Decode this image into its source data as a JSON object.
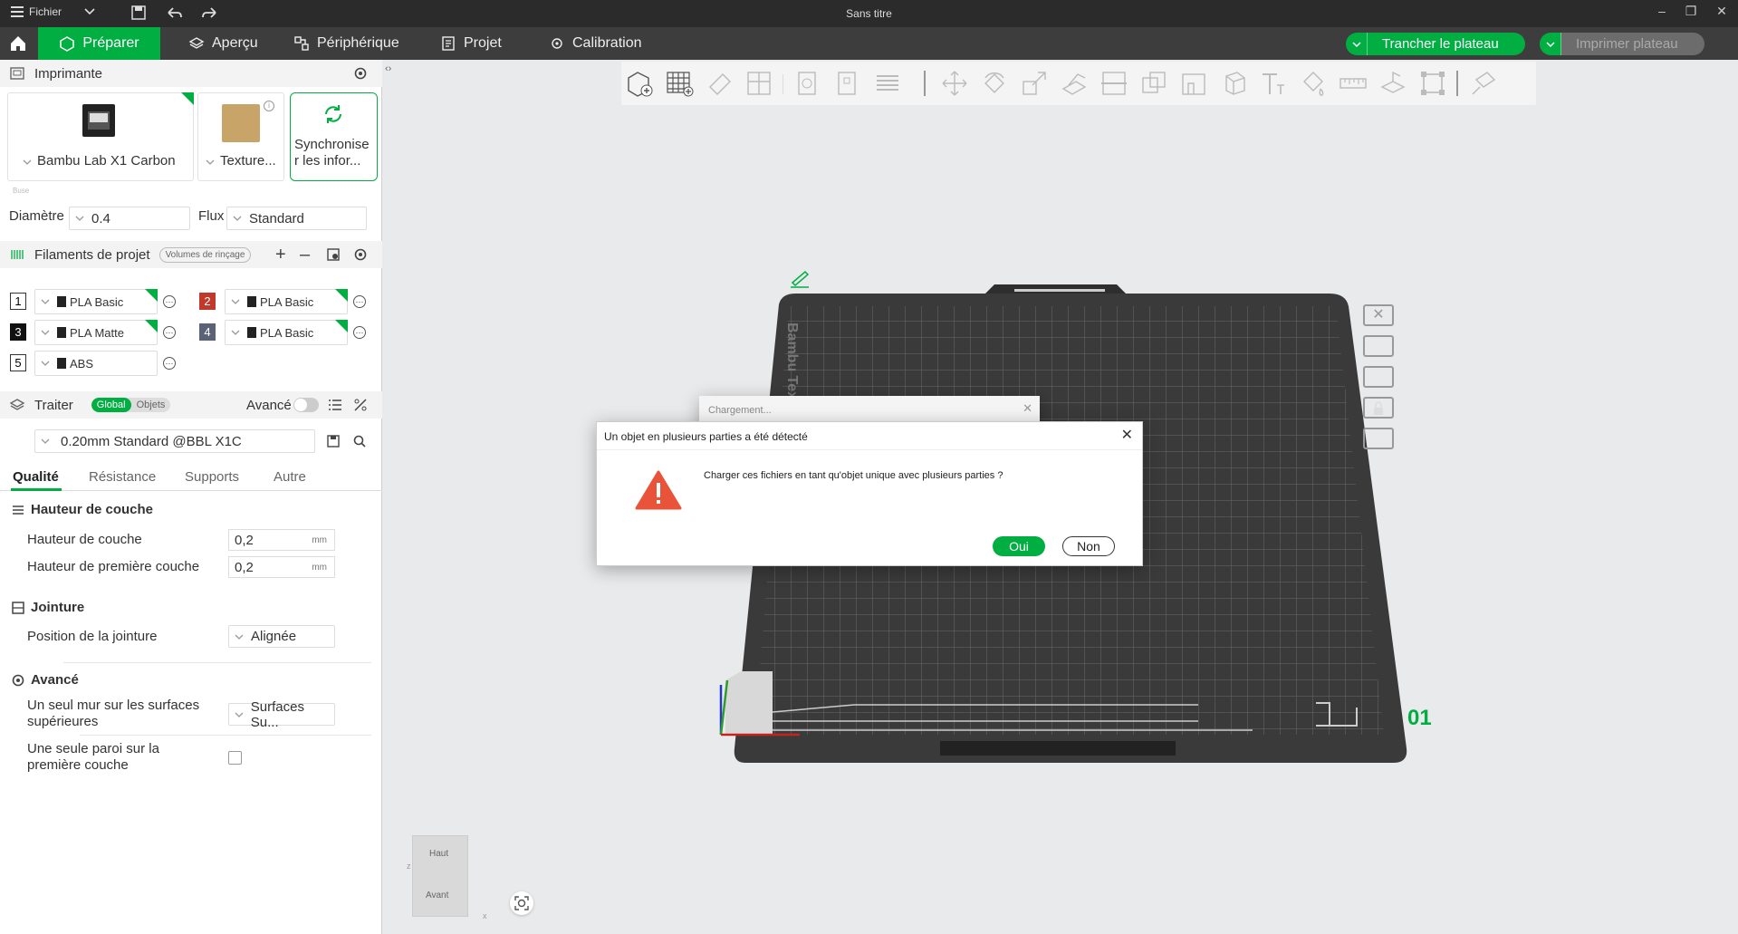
{
  "titlebar": {
    "menu_label": "Fichier",
    "title": "Sans titre"
  },
  "menubar": {
    "tabs": [
      {
        "label": "Préparer"
      },
      {
        "label": "Aperçu"
      },
      {
        "label": "Périphérique"
      },
      {
        "label": "Projet"
      },
      {
        "label": "Calibration"
      }
    ],
    "slice_button": "Trancher le plateau",
    "print_button": "Imprimer plateau"
  },
  "printer": {
    "section_title": "Imprimante",
    "printer_name": "Bambu Lab X1 Carbon",
    "plate_name": "Texture...",
    "sync_label_1": "Synchronise",
    "sync_label_2": "r les infor...",
    "nozzle_caption": "Buse",
    "diameter_label": "Diamètre",
    "diameter_value": "0.4",
    "flow_label": "Flux",
    "flow_value": "Standard"
  },
  "filaments": {
    "section_title": "Filaments de projet",
    "flush_button": "Volumes de rinçage",
    "items": [
      {
        "index": "1",
        "name": "PLA Basic",
        "color": "#ffffff"
      },
      {
        "index": "2",
        "name": "PLA Basic",
        "color": "#c0392b"
      },
      {
        "index": "3",
        "name": "PLA Matte",
        "color": "#111111"
      },
      {
        "index": "4",
        "name": "PLA Basic",
        "color": "#5a6275"
      },
      {
        "index": "5",
        "name": "ABS",
        "color": "#ffffff"
      }
    ]
  },
  "process": {
    "section_title": "Traiter",
    "toggle_global": "Global",
    "toggle_objects": "Objets",
    "advanced_label": "Avancé",
    "preset": "0.20mm Standard @BBL X1C",
    "tabs": [
      "Qualité",
      "Résistance",
      "Supports",
      "Autre"
    ],
    "groups": {
      "layer_height": {
        "title": "Hauteur de couche",
        "layer_height_label": "Hauteur de couche",
        "layer_height_value": "0,2",
        "first_layer_label": "Hauteur de première couche",
        "first_layer_value": "0,2",
        "unit": "mm"
      },
      "seam": {
        "title": "Jointure",
        "position_label": "Position de la jointure",
        "position_value": "Alignée"
      },
      "advanced": {
        "title": "Avancé",
        "single_wall_top_label_1": "Un seul mur sur les surfaces",
        "single_wall_top_label_2": "supérieures",
        "single_wall_top_value": "Surfaces Su...",
        "single_wall_first_label_1": "Une seule paroi sur la",
        "single_wall_first_label_2": "première couche",
        "single_wall_first_checked": false
      }
    }
  },
  "viewport": {
    "plate_number": "01",
    "plate_brand": "Bambu Text",
    "view_cube_top": "Haut",
    "view_cube_front": "Avant",
    "axis_x": "x",
    "axis_z": "z"
  },
  "loading_dialog": {
    "title": "Chargement..."
  },
  "multipart_dialog": {
    "title": "Un objet en plusieurs parties a été détecté",
    "message": "Charger ces fichiers en tant qu'objet unique avec plusieurs parties ?",
    "yes": "Oui",
    "no": "Non"
  },
  "colors": {
    "accent": "#00ae42",
    "warning": "#e8533a"
  }
}
